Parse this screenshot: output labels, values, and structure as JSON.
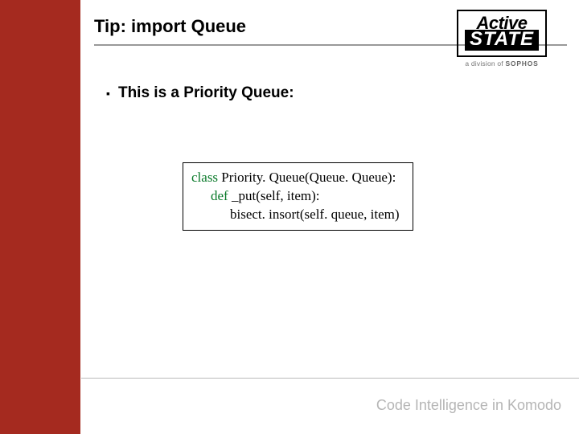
{
  "header": {
    "title": "Tip: import Queue"
  },
  "logo": {
    "line1": "Active",
    "line2": "STATE",
    "caption_prefix": "a division of ",
    "caption_brand": "SOPHOS"
  },
  "content": {
    "bullet1": "This is a Priority Queue:",
    "code": {
      "kw_class": "class",
      "class_sig": " Priority. Queue(Queue. Queue):",
      "kw_def": "def",
      "def_sig": " _put(self, item):",
      "body": "bisect. insort(self. queue, item)"
    }
  },
  "footer": {
    "text": "Code Intelligence in Komodo"
  }
}
